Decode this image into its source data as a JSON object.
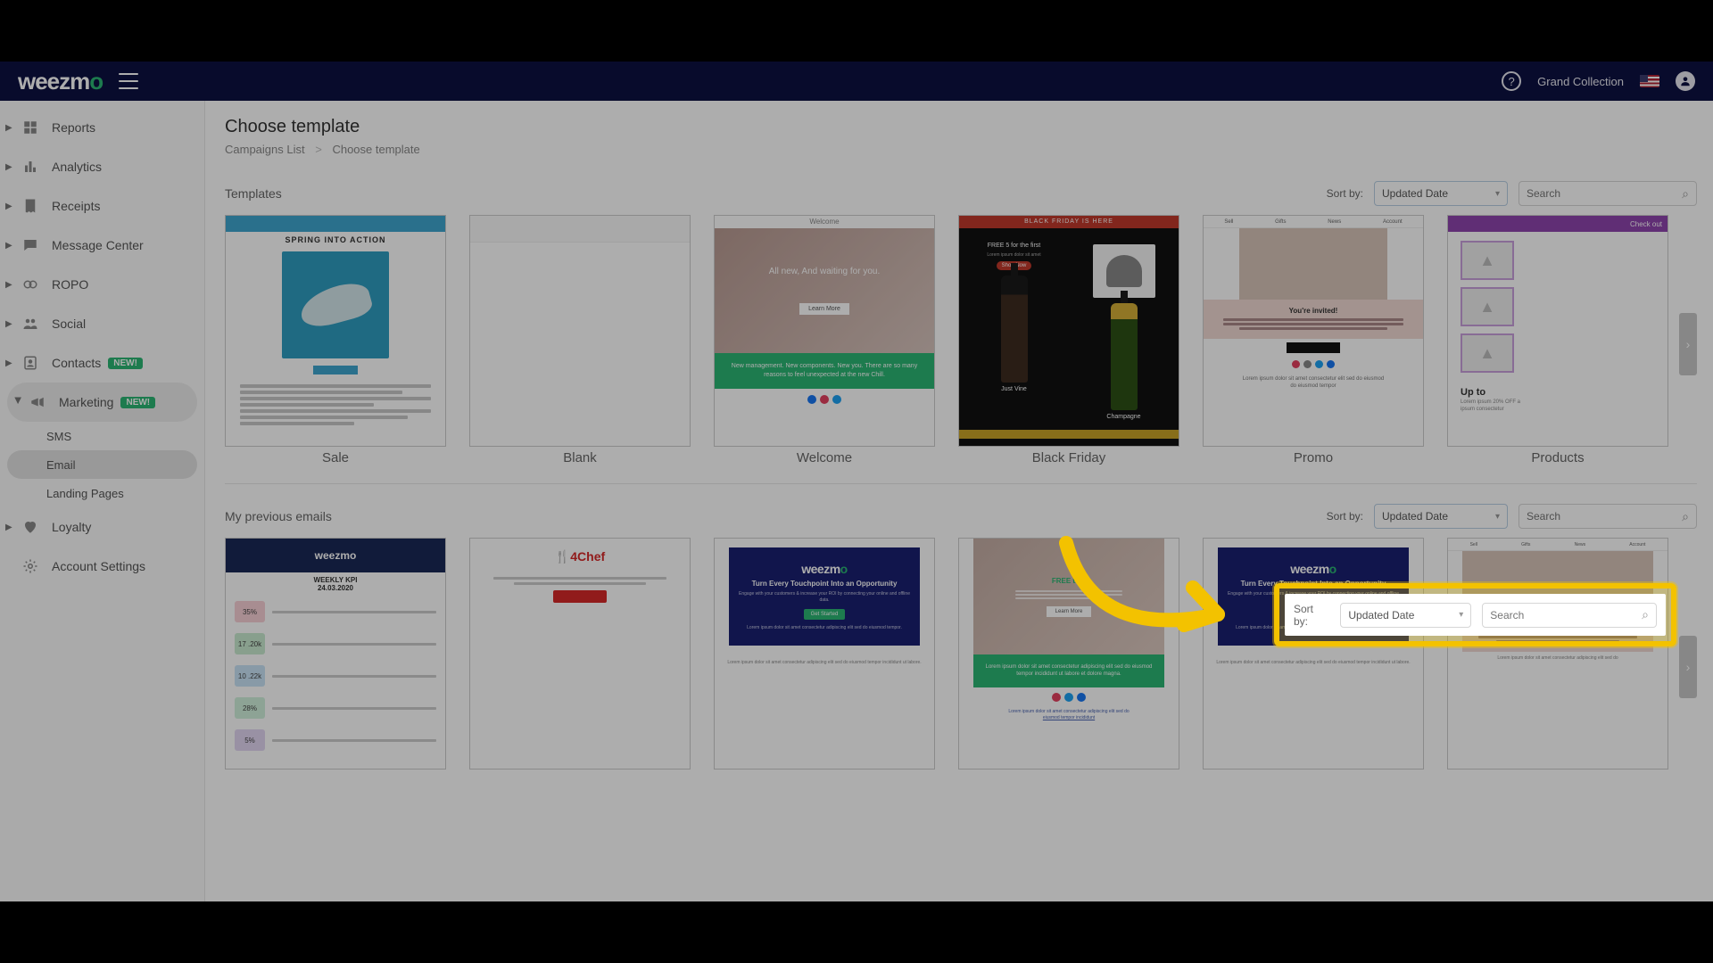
{
  "header": {
    "brand_pre": "weezm",
    "brand_o": "o",
    "org": "Grand Collection"
  },
  "sidebar": {
    "items": [
      {
        "label": "Reports"
      },
      {
        "label": "Analytics"
      },
      {
        "label": "Receipts"
      },
      {
        "label": "Message Center"
      },
      {
        "label": "ROPO"
      },
      {
        "label": "Social"
      },
      {
        "label": "Contacts",
        "badge": "NEW!"
      },
      {
        "label": "Marketing",
        "badge": "NEW!"
      },
      {
        "label": "Loyalty"
      },
      {
        "label": "Account Settings"
      }
    ],
    "marketing_sub": [
      {
        "label": "SMS"
      },
      {
        "label": "Email"
      },
      {
        "label": "Landing Pages"
      }
    ]
  },
  "page": {
    "title": "Choose template",
    "breadcrumb": {
      "a": "Campaigns List",
      "b": "Choose template"
    }
  },
  "templates": {
    "section_label": "Templates",
    "sort_label": "Sort by:",
    "sort_value": "Updated Date",
    "search_placeholder": "Search",
    "cards": [
      {
        "label": "Sale"
      },
      {
        "label": "Blank"
      },
      {
        "label": "Welcome"
      },
      {
        "label": "Black Friday"
      },
      {
        "label": "Promo"
      },
      {
        "label": "Products"
      }
    ],
    "thumbs": {
      "sale_title": "SPRING INTO ACTION",
      "welcome_bar": "Welcome",
      "welcome_hero": "All new, And waiting for you.",
      "welcome_btn": "Learn More",
      "welcome_green": "New management. New components. New you. There are so many reasons to feel unexpected at the new Chill.",
      "bf_bar": "BLACK FRIDAY IS HERE",
      "bf_free": "FREE 5 for the first",
      "bf_shop": "Shop Now",
      "bf_name1": "Just Vine",
      "bf_name2": "Champagne",
      "promo_big": "You're invited!",
      "products_bar": "Check out",
      "products_up": "Up to"
    }
  },
  "previous": {
    "section_label": "My previous emails",
    "sort_label": "Sort by:",
    "sort_value": "Updated Date",
    "search_placeholder": "Search",
    "thumbs": {
      "p1_brand": "weezmo",
      "p1_date": "24.03.2020",
      "p2_brand": "4Chef",
      "wz_head": "Turn Every Touchpoint Into an Opportunity",
      "wz_sub": "Engage with your customers & increase your ROI by connecting your online and offline data.",
      "wz_btn": "Get Started",
      "p4_title": "FREE trial"
    }
  }
}
